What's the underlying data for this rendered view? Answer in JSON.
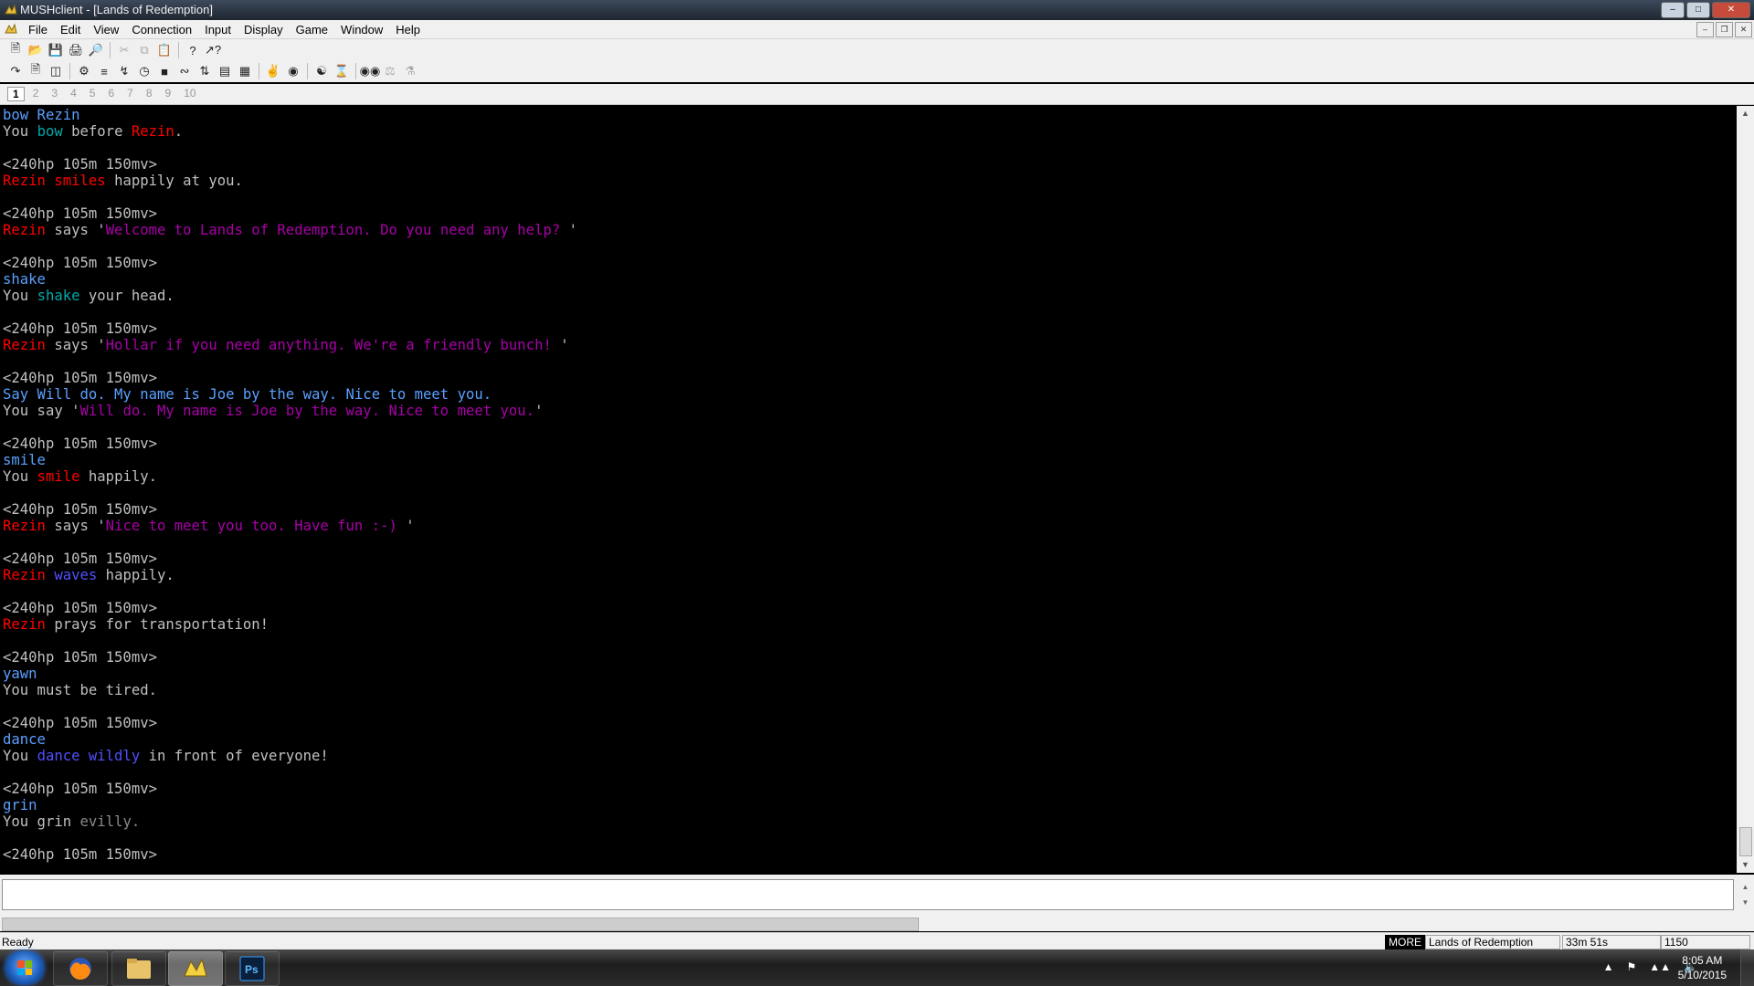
{
  "window": {
    "title": "MUSHclient - [Lands of Redemption]"
  },
  "menu": {
    "items": [
      "File",
      "Edit",
      "View",
      "Connection",
      "Input",
      "Display",
      "Game",
      "Window",
      "Help"
    ]
  },
  "toolbar1": [
    "new-document-icon",
    "open-folder-icon",
    "save-icon",
    "print-icon",
    "print-preview-icon",
    "cut-icon",
    "copy-icon",
    "paste-icon",
    "help-icon",
    "context-help-icon"
  ],
  "toolbar2": [
    "connect-icon",
    "log-icon",
    "split-icon",
    "world-config-icon",
    "macros-icon",
    "triggers-icon",
    "timers-icon",
    "aliases-icon",
    "variables-icon",
    "scripting-icon",
    "notepad-icon",
    "activity-list-icon",
    "world-list-icon",
    "chat-icon",
    "plugins-icon",
    "map-icon",
    "find-icon",
    "mapper-icon",
    "mapper-config-icon",
    "binoculars-icon"
  ],
  "world_tabs": [
    "1",
    "2",
    "3",
    "4",
    "5",
    "6",
    "7",
    "8",
    "9",
    "10"
  ],
  "active_world_tab": "1",
  "colors": {
    "white": "#c0c0c0",
    "red": "#ff0000",
    "cyan": "#00a8a8",
    "blue": "#2b6fff",
    "magenta": "#a800a8",
    "bright_blue": "#5050ff",
    "gray": "#8a8a8a",
    "lblue": "#5aa0ff"
  },
  "output_lines": [
    [
      [
        "bow Rezin",
        "lblue"
      ]
    ],
    [
      [
        "You ",
        "white"
      ],
      [
        "bow",
        "cyan"
      ],
      [
        " before ",
        "white"
      ],
      [
        "Rezin",
        "red"
      ],
      [
        ".",
        "white"
      ]
    ],
    [
      [
        "",
        "white"
      ]
    ],
    [
      [
        "<240hp 105m 150mv>",
        "white"
      ]
    ],
    [
      [
        "Rezin ",
        "red"
      ],
      [
        "smiles",
        "red"
      ],
      [
        " happily at you.",
        "white"
      ]
    ],
    [
      [
        "",
        "white"
      ]
    ],
    [
      [
        "<240hp 105m 150mv>",
        "white"
      ]
    ],
    [
      [
        "Rezin",
        "red"
      ],
      [
        " says '",
        "white"
      ],
      [
        "Welcome to Lands of Redemption. Do you need any help? ",
        "magenta"
      ],
      [
        "'",
        "white"
      ]
    ],
    [
      [
        "",
        "white"
      ]
    ],
    [
      [
        "<240hp 105m 150mv>",
        "white"
      ]
    ],
    [
      [
        "shake",
        "lblue"
      ]
    ],
    [
      [
        "You ",
        "white"
      ],
      [
        "shake",
        "cyan"
      ],
      [
        " your head.",
        "white"
      ]
    ],
    [
      [
        "",
        "white"
      ]
    ],
    [
      [
        "<240hp 105m 150mv>",
        "white"
      ]
    ],
    [
      [
        "Rezin",
        "red"
      ],
      [
        " says '",
        "white"
      ],
      [
        "Hollar if you need anything. We're a friendly bunch! ",
        "magenta"
      ],
      [
        "'",
        "white"
      ]
    ],
    [
      [
        "",
        "white"
      ]
    ],
    [
      [
        "<240hp 105m 150mv>",
        "white"
      ]
    ],
    [
      [
        "Say Will do. My name is Joe by the way. Nice to meet you.",
        "lblue"
      ]
    ],
    [
      [
        "You say '",
        "white"
      ],
      [
        "Will do. My name is Joe by the way. Nice to meet you.",
        "magenta"
      ],
      [
        "'",
        "white"
      ]
    ],
    [
      [
        "",
        "white"
      ]
    ],
    [
      [
        "<240hp 105m 150mv>",
        "white"
      ]
    ],
    [
      [
        "smile",
        "lblue"
      ]
    ],
    [
      [
        "You ",
        "white"
      ],
      [
        "smile",
        "red"
      ],
      [
        " happily.",
        "white"
      ]
    ],
    [
      [
        "",
        "white"
      ]
    ],
    [
      [
        "<240hp 105m 150mv>",
        "white"
      ]
    ],
    [
      [
        "Rezin",
        "red"
      ],
      [
        " says '",
        "white"
      ],
      [
        "Nice to meet you too. Have fun :-) ",
        "magenta"
      ],
      [
        "'",
        "white"
      ]
    ],
    [
      [
        "",
        "white"
      ]
    ],
    [
      [
        "<240hp 105m 150mv>",
        "white"
      ]
    ],
    [
      [
        "Rezin ",
        "red"
      ],
      [
        "waves",
        "bright_blue"
      ],
      [
        " happily.",
        "white"
      ]
    ],
    [
      [
        "",
        "white"
      ]
    ],
    [
      [
        "<240hp 105m 150mv>",
        "white"
      ]
    ],
    [
      [
        "Rezin",
        "red"
      ],
      [
        " prays for transportation!",
        "white"
      ]
    ],
    [
      [
        "",
        "white"
      ]
    ],
    [
      [
        "<240hp 105m 150mv>",
        "white"
      ]
    ],
    [
      [
        "yawn",
        "lblue"
      ]
    ],
    [
      [
        "You must be tired.",
        "white"
      ]
    ],
    [
      [
        "",
        "white"
      ]
    ],
    [
      [
        "<240hp 105m 150mv>",
        "white"
      ]
    ],
    [
      [
        "dance",
        "lblue"
      ]
    ],
    [
      [
        "You ",
        "white"
      ],
      [
        "dance wildly",
        "bright_blue"
      ],
      [
        " in front of everyone!",
        "white"
      ]
    ],
    [
      [
        "",
        "white"
      ]
    ],
    [
      [
        "<240hp 105m 150mv>",
        "white"
      ]
    ],
    [
      [
        "grin",
        "lblue"
      ]
    ],
    [
      [
        "You grin ",
        "white"
      ],
      [
        "evilly.",
        "gray"
      ]
    ],
    [
      [
        "",
        "white"
      ]
    ],
    [
      [
        "<240hp 105m 150mv>",
        "white"
      ]
    ]
  ],
  "command_input": {
    "value": ""
  },
  "status": {
    "ready": "Ready",
    "more": "MORE",
    "world": "Lands of Redemption",
    "time": "33m 51s",
    "lines": "1150"
  },
  "taskbar": {
    "time": "8:05 AM",
    "date": "5/10/2015"
  }
}
